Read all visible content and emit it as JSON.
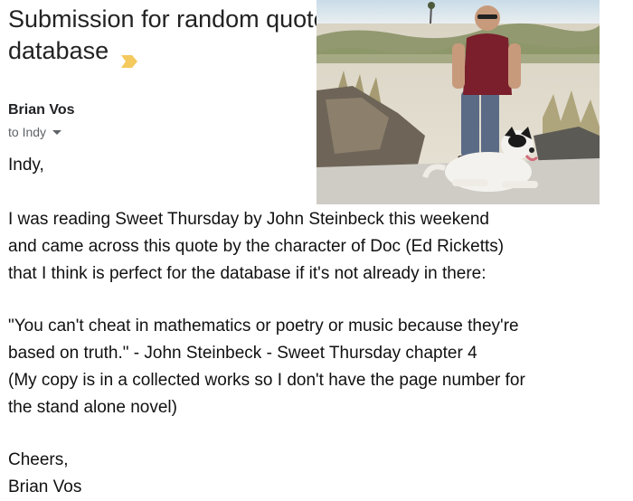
{
  "email": {
    "subject_line1": "Submission for random quotes",
    "subject_line2": "database",
    "important_marker_icon": "important-arrow-icon",
    "important_marker_color": "#f4c95d",
    "sender_name": "Brian Vos",
    "recipient_label": "to Indy",
    "greeting": "Indy,",
    "paragraph1": [
      "I was reading Sweet Thursday by John Steinbeck this weekend",
      "and came across this quote by the character of Doc (Ed Ricketts)",
      "that I think is perfect for the database if it's not already in there:"
    ],
    "paragraph2": [
      "\"You can't cheat in mathematics or poetry or music because they're",
      "based on truth.\" - John Steinbeck - Sweet Thursday chapter 4",
      "(My copy is in a collected works so I don't have the page number for",
      "the stand alone novel)"
    ],
    "signoff": "Cheers,",
    "signature": "Brian Vos"
  }
}
